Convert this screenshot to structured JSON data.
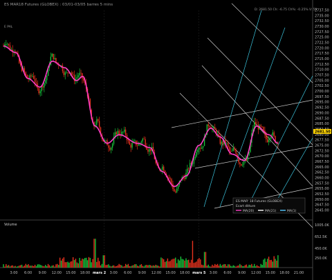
{
  "header": {
    "title": "ES MAR18 Futures (GLOBEX) : 03/01-03/05 barres 5 mins",
    "ohlc_readout": "D: 2681.50  Ch: -6.75  Ch%: -0.25%  V: 59",
    "sub_label": "E PAL"
  },
  "price_axis": {
    "labels": [
      "2737.50",
      "2735.00",
      "2732.50",
      "2730.00",
      "2727.50",
      "2725.00",
      "2722.50",
      "2720.00",
      "2717.50",
      "2715.00",
      "2712.50",
      "2710.00",
      "2707.50",
      "2705.00",
      "2702.50",
      "2700.00",
      "2697.50",
      "2695.00",
      "2692.50",
      "2690.00",
      "2687.50",
      "2685.00",
      "2682.50",
      "2680.00",
      "2677.50",
      "2675.00",
      "2672.50",
      "2670.00",
      "2667.50",
      "2665.00",
      "2662.50",
      "2660.00",
      "2657.50",
      "2655.00",
      "2652.50",
      "2650.00",
      "2647.50",
      "2645.00"
    ],
    "last_price": "2681.50",
    "last_price_color": "#ffd400"
  },
  "volume_axis": {
    "labels": [
      "1005.0K",
      "652.5K",
      "450.0K",
      "250.0K"
    ],
    "title": "Volume"
  },
  "time_axis": {
    "labels": [
      "3:00",
      "6:00",
      "9:00",
      "12:00",
      "15:00",
      "18:00",
      "mars 2",
      "3:00",
      "6:00",
      "9:00",
      "12:00",
      "15:00",
      "18:00",
      "mars 5",
      "3:00",
      "6:00",
      "9:00",
      "12:00",
      "15:00",
      "18:00",
      "21:00"
    ],
    "bold": [
      "mars 2",
      "mars 5"
    ]
  },
  "legend": {
    "title": "ES MAR' 18 Futures (GLOBEX)",
    "subtitle": "Ecart ditture",
    "items": [
      {
        "label": "MA(20)",
        "color": "#ff3cc8"
      },
      {
        "label": "MA(21)",
        "color": "#ffffff"
      },
      {
        "label": "MA(1)",
        "color": "#55c8ff"
      }
    ]
  },
  "colors": {
    "up": "#19c23a",
    "down": "#e8321e",
    "ma": "#ff3cc8",
    "channel_white": "#cfcfcf",
    "channel_cyan": "#3cc6e0"
  },
  "chart_data": {
    "type": "candlestick",
    "y_range": [
      2645,
      2737.5
    ],
    "price_anchors_ma": [
      {
        "t": 0,
        "price": 2721
      },
      {
        "t": 0.04,
        "price": 2718
      },
      {
        "t": 0.08,
        "price": 2706
      },
      {
        "t": 0.12,
        "price": 2702
      },
      {
        "t": 0.16,
        "price": 2714
      },
      {
        "t": 0.2,
        "price": 2711
      },
      {
        "t": 0.24,
        "price": 2705
      },
      {
        "t": 0.26,
        "price": 2707
      },
      {
        "t": 0.3,
        "price": 2684
      },
      {
        "t": 0.34,
        "price": 2676
      },
      {
        "t": 0.38,
        "price": 2680
      },
      {
        "t": 0.44,
        "price": 2676
      },
      {
        "t": 0.48,
        "price": 2674
      },
      {
        "t": 0.52,
        "price": 2663
      },
      {
        "t": 0.56,
        "price": 2656
      },
      {
        "t": 0.6,
        "price": 2661
      },
      {
        "t": 0.64,
        "price": 2675
      },
      {
        "t": 0.68,
        "price": 2683
      },
      {
        "t": 0.71,
        "price": 2679
      },
      {
        "t": 0.75,
        "price": 2671
      },
      {
        "t": 0.79,
        "price": 2668
      },
      {
        "t": 0.83,
        "price": 2684
      },
      {
        "t": 0.87,
        "price": 2680
      },
      {
        "t": 0.9,
        "price": 2676
      }
    ],
    "volume_spikes": [
      {
        "t": 0.3,
        "value": 700
      },
      {
        "t": 0.33,
        "value": 300
      },
      {
        "t": 0.62,
        "value": 650
      },
      {
        "t": 0.66,
        "value": 380
      },
      {
        "t": 0.9,
        "value": 300
      }
    ]
  }
}
